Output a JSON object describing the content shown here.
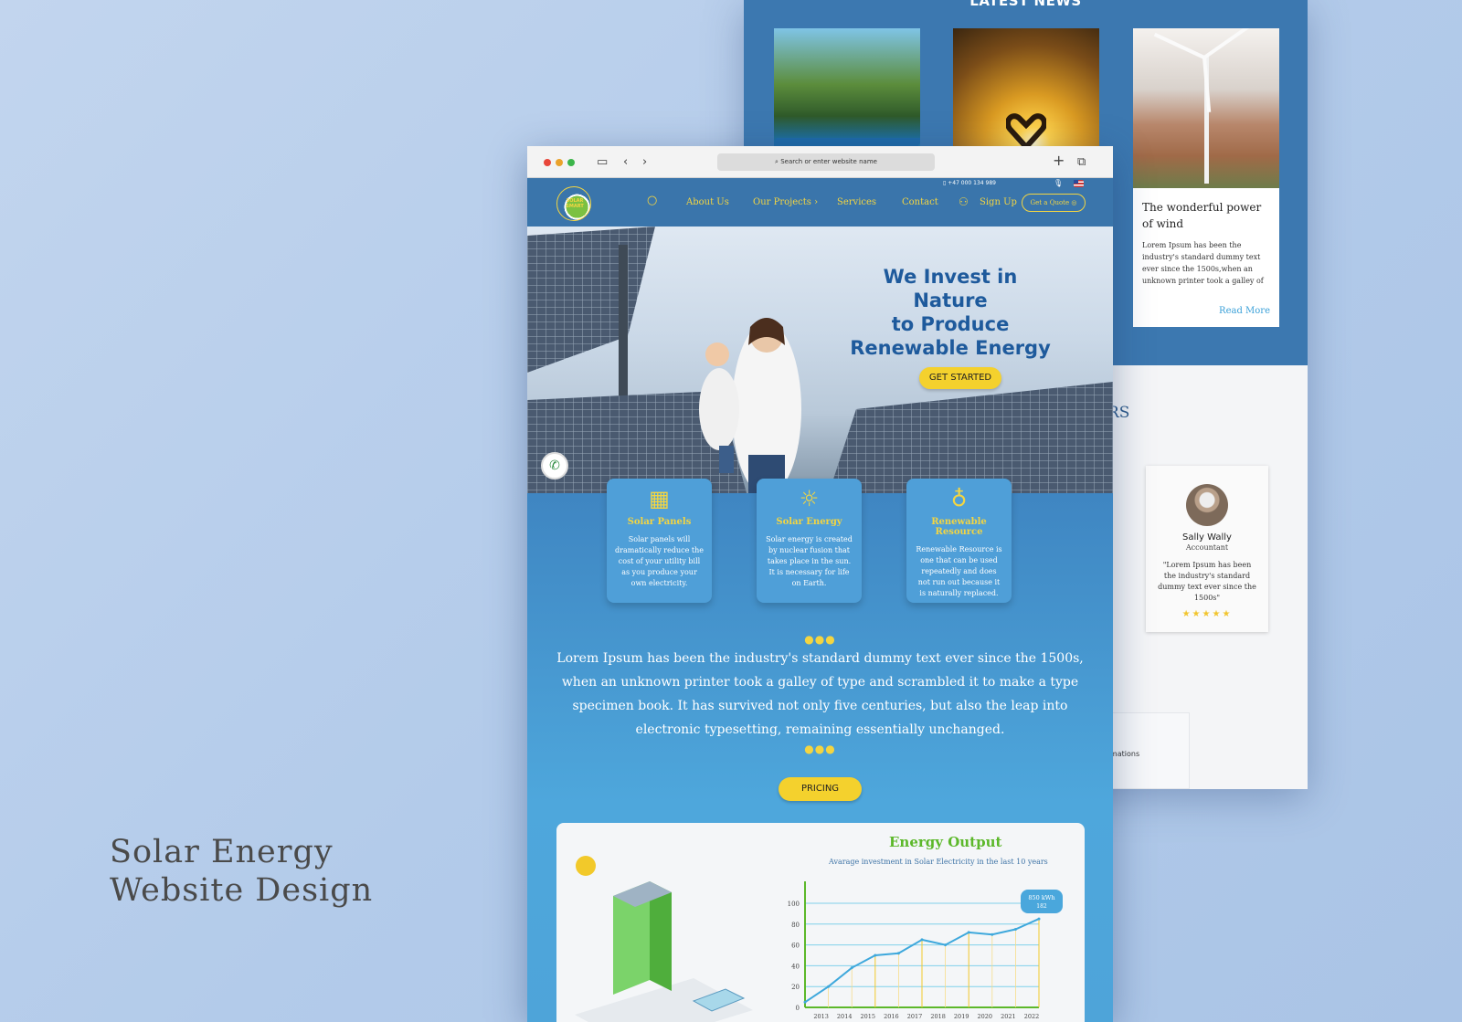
{
  "caption": {
    "line1": "Solar Energy",
    "line2": "Website Design"
  },
  "back_page": {
    "news_heading": "LATEST NEWS",
    "news_card": {
      "title": "The wonderful power of wind",
      "text": "Lorem Ipsum has been the industry's standard dummy text ever since the 1500s,when an unknown printer took a galley of type and scrambled it to make a",
      "link": "Read More"
    },
    "section_heading_partial": "RS",
    "testimonial": {
      "name": "Sally Wally",
      "role": "Accountant",
      "quote": "\"Lorem Ipsum has been the industry's standard dummy text ever since the 1500s\"",
      "stars": "★★★★★"
    },
    "info_partial": "nformations"
  },
  "browser": {
    "url_placeholder": "Search or enter website name",
    "back_icon": "chevron-left",
    "forward_icon": "chevron-right",
    "new_tab_icon": "plus",
    "tabs_icon": "copy"
  },
  "nav": {
    "phone": "+47 000 134 989",
    "logo_text": "SOLAR SMART",
    "links": [
      "About Us",
      "Our Projects ›",
      "Services",
      "Contact"
    ],
    "signup": "Sign Up",
    "quote_button": "Get a Quote"
  },
  "hero": {
    "title_lines": [
      "We Invest in",
      "Nature",
      "to Produce",
      "Renewable Energy"
    ],
    "cta": "GET STARTED"
  },
  "features": [
    {
      "icon": "solar-panel",
      "title": "Solar Panels",
      "text": "Solar panels will dramatically reduce the cost of your utility bill as you produce your own electricity."
    },
    {
      "icon": "sun",
      "title": "Solar Energy",
      "text": "Solar energy is created by nuclear fusion that takes place in the sun. It is necessary for life on Earth."
    },
    {
      "icon": "lightbulb",
      "title": "Renewable Resource",
      "text": "Renewable Resource is one that can be used repeatedly and does not run out because it is naturally replaced."
    }
  ],
  "lorem": "Lorem Ipsum has been the industry's standard dummy text ever since the 1500s, when an unknown printer took a galley of type and scrambled it to make a type specimen book. It has survived not only five centuries, but also the leap into electronic typesetting, remaining essentially unchanged.",
  "pricing_button": "PRICING",
  "colors": {
    "accent_yellow": "#f4d12d",
    "brand_blue": "#3a75ab",
    "chart_green": "#5cb82a",
    "line_blue": "#3ea8dc"
  },
  "chart_data": {
    "type": "line",
    "title": "Energy Output",
    "subtitle": "Avarage investment in Solar Electricity in the last 10 years",
    "x": [
      "2013",
      "2014",
      "2015",
      "2016",
      "2017",
      "2018",
      "2019",
      "2020",
      "2021",
      "2022"
    ],
    "series": [
      {
        "values": [
          5,
          20,
          38,
          50,
          52,
          65,
          60,
          72,
          70,
          75,
          85
        ]
      }
    ],
    "x_points": [
      0,
      1,
      2,
      3,
      4,
      5,
      6,
      7,
      8,
      9,
      10
    ],
    "yticks": [
      "0",
      "20",
      "40",
      "60",
      "80",
      "100"
    ],
    "ylim": [
      0,
      100
    ],
    "tooltip": "850 kWh 182",
    "grid": true
  }
}
